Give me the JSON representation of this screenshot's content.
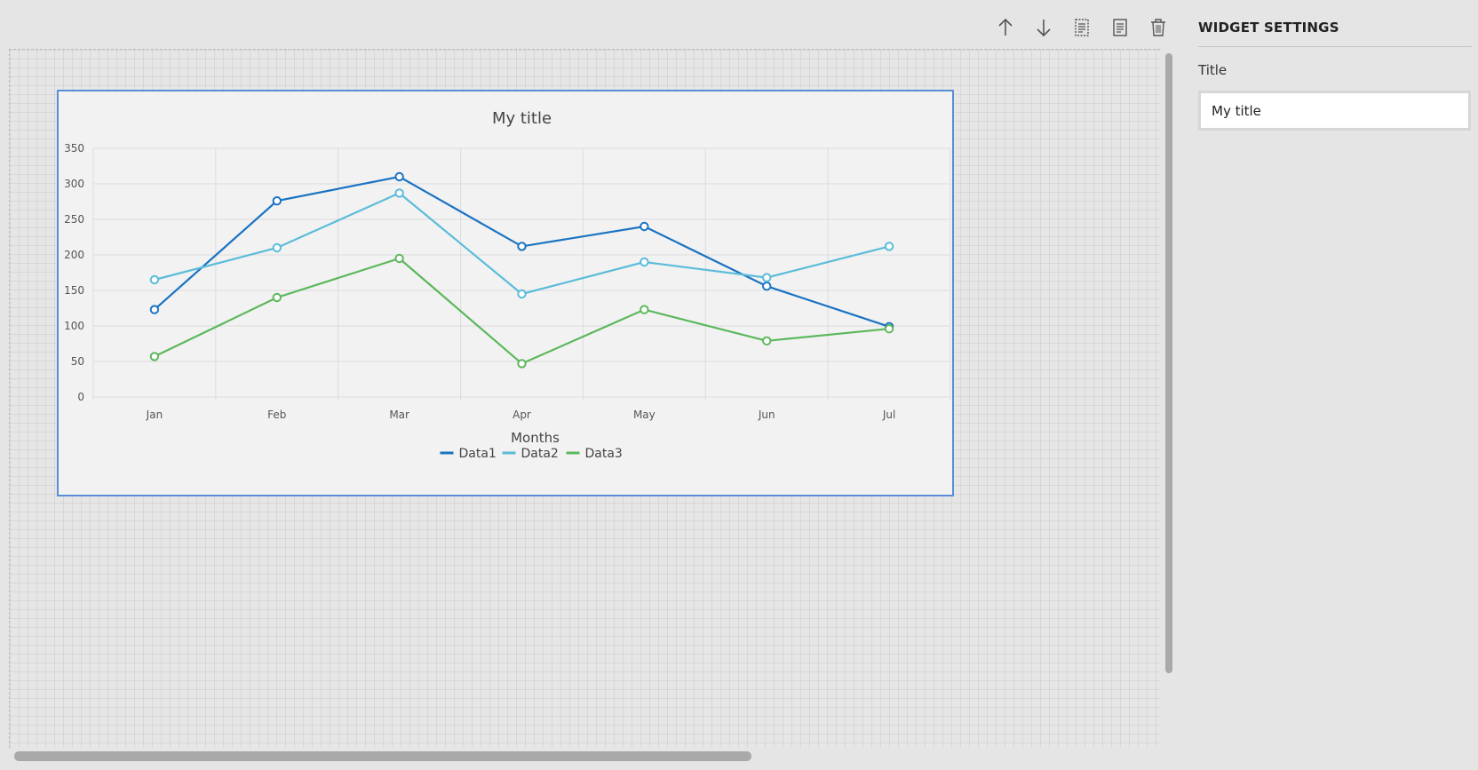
{
  "toolbar": {
    "icons": [
      "arrow-up-icon",
      "arrow-down-icon",
      "copy-icon",
      "document-icon",
      "trash-icon"
    ]
  },
  "settings_panel": {
    "heading": "WIDGET SETTINGS",
    "title_label": "Title",
    "title_value": "My title"
  },
  "chart_data": {
    "type": "line",
    "title": "My title",
    "xlabel": "Months",
    "ylabel": "",
    "categories": [
      "Jan",
      "Feb",
      "Mar",
      "Apr",
      "May",
      "Jun",
      "Jul"
    ],
    "ylim": [
      0,
      350
    ],
    "yticks": [
      0,
      50,
      100,
      150,
      200,
      250,
      300,
      350
    ],
    "grid": true,
    "legend_position": "bottom-center",
    "series": [
      {
        "name": "Data1",
        "color": "#1a73c2",
        "values": [
          123,
          276,
          310,
          212,
          240,
          156,
          99
        ]
      },
      {
        "name": "Data2",
        "color": "#5bbcd9",
        "values": [
          165,
          210,
          287,
          145,
          190,
          168,
          212
        ]
      },
      {
        "name": "Data3",
        "color": "#5cb85c",
        "values": [
          57,
          140,
          195,
          47,
          123,
          79,
          96
        ]
      }
    ]
  }
}
